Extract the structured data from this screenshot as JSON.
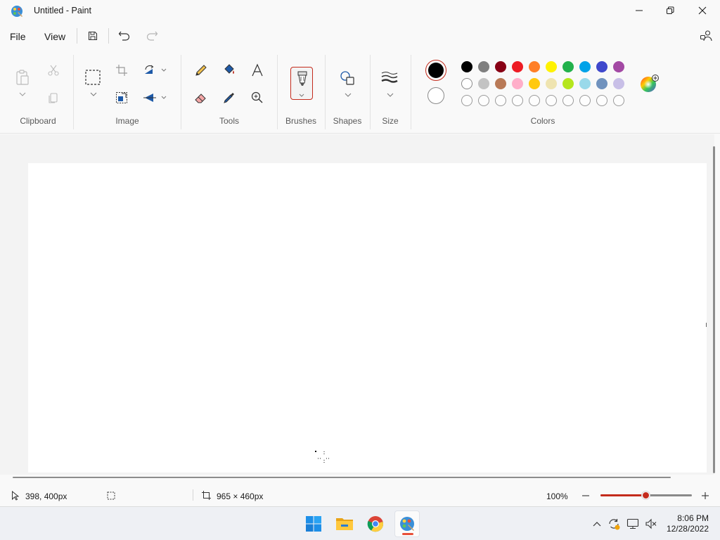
{
  "window": {
    "title": "Untitled - Paint"
  },
  "menu": {
    "file": "File",
    "view": "View"
  },
  "ribbon": {
    "groups": {
      "clipboard": "Clipboard",
      "image": "Image",
      "tools": "Tools",
      "brushes": "Brushes",
      "shapes": "Shapes",
      "size": "Size",
      "colors": "Colors"
    },
    "palette": {
      "row1": [
        "#000000",
        "#7f7f7f",
        "#880015",
        "#ed1c24",
        "#ff7f27",
        "#fff200",
        "#22b14c",
        "#00a2e8",
        "#3f48cc",
        "#a349a4"
      ],
      "row2": [
        "#ffffff",
        "#c3c3c3",
        "#b97a57",
        "#ffaec9",
        "#ffc90e",
        "#efe4b0",
        "#b5e61d",
        "#99d9ea",
        "#7092be",
        "#c8bfe7"
      ],
      "row3_empty_count": 10
    },
    "primary_color": "#000000",
    "secondary_color": "#ffffff"
  },
  "status": {
    "cursor_position": "398, 400px",
    "canvas_size": "965 × 460px",
    "zoom": "100%",
    "zoom_fraction": 0.5
  },
  "taskbar": {
    "time": "8:06 PM",
    "date": "12/28/2022"
  }
}
